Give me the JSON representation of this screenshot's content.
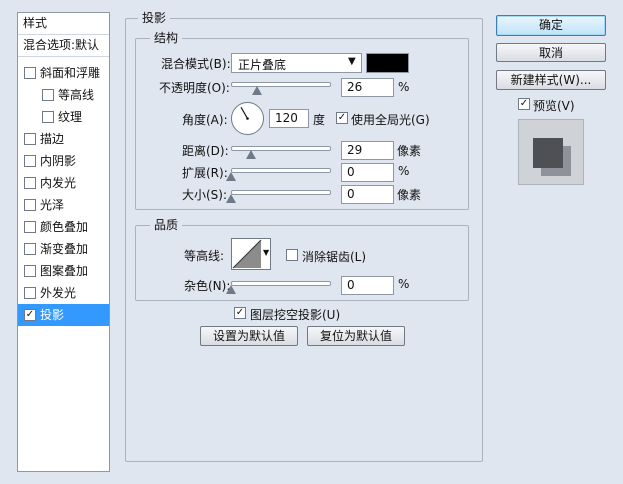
{
  "sidebar": {
    "header": "样式",
    "blend_options": "混合选项:默认",
    "items": [
      {
        "label": "斜面和浮雕",
        "checked": false,
        "indent": 0
      },
      {
        "label": "等高线",
        "checked": false,
        "indent": 1
      },
      {
        "label": "纹理",
        "checked": false,
        "indent": 1
      },
      {
        "label": "描边",
        "checked": false,
        "indent": 0
      },
      {
        "label": "内阴影",
        "checked": false,
        "indent": 0
      },
      {
        "label": "内发光",
        "checked": false,
        "indent": 0
      },
      {
        "label": "光泽",
        "checked": false,
        "indent": 0
      },
      {
        "label": "颜色叠加",
        "checked": false,
        "indent": 0
      },
      {
        "label": "渐变叠加",
        "checked": false,
        "indent": 0
      },
      {
        "label": "图案叠加",
        "checked": false,
        "indent": 0
      },
      {
        "label": "外发光",
        "checked": false,
        "indent": 0
      },
      {
        "label": "投影",
        "checked": true,
        "indent": 0
      }
    ]
  },
  "main": {
    "title": "投影",
    "structure": {
      "legend": "结构",
      "blend_mode_label": "混合模式(B):",
      "blend_mode_value": "正片叠底",
      "color": "#000000",
      "opacity_label": "不透明度(O):",
      "opacity_value": "26",
      "opacity_fraction": 0.26,
      "angle_label": "角度(A):",
      "angle_value": "120",
      "angle_unit": "度",
      "global_light_label": "使用全局光(G)",
      "global_light_checked": true,
      "distance_label": "距离(D):",
      "distance_value": "29",
      "distance_fraction": 0.2,
      "spread_label": "扩展(R):",
      "spread_value": "0",
      "spread_fraction": 0,
      "size_label": "大小(S):",
      "size_value": "0",
      "size_fraction": 0,
      "percent_unit": "%",
      "pixel_unit": "像素"
    },
    "quality": {
      "legend": "品质",
      "contour_label": "等高线:",
      "anti_alias_label": "消除锯齿(L)",
      "noise_label": "杂色(N):",
      "noise_value": "0",
      "noise_fraction": 0,
      "percent_unit": "%"
    },
    "knockout_label": "图层挖空投影(U)",
    "knockout_checked": true,
    "make_default_label": "设置为默认值",
    "reset_default_label": "复位为默认值"
  },
  "actions": {
    "ok_label": "确定",
    "cancel_label": "取消",
    "new_style_label": "新建样式(W)...",
    "preview_label": "预览(V)",
    "preview_checked": true
  }
}
